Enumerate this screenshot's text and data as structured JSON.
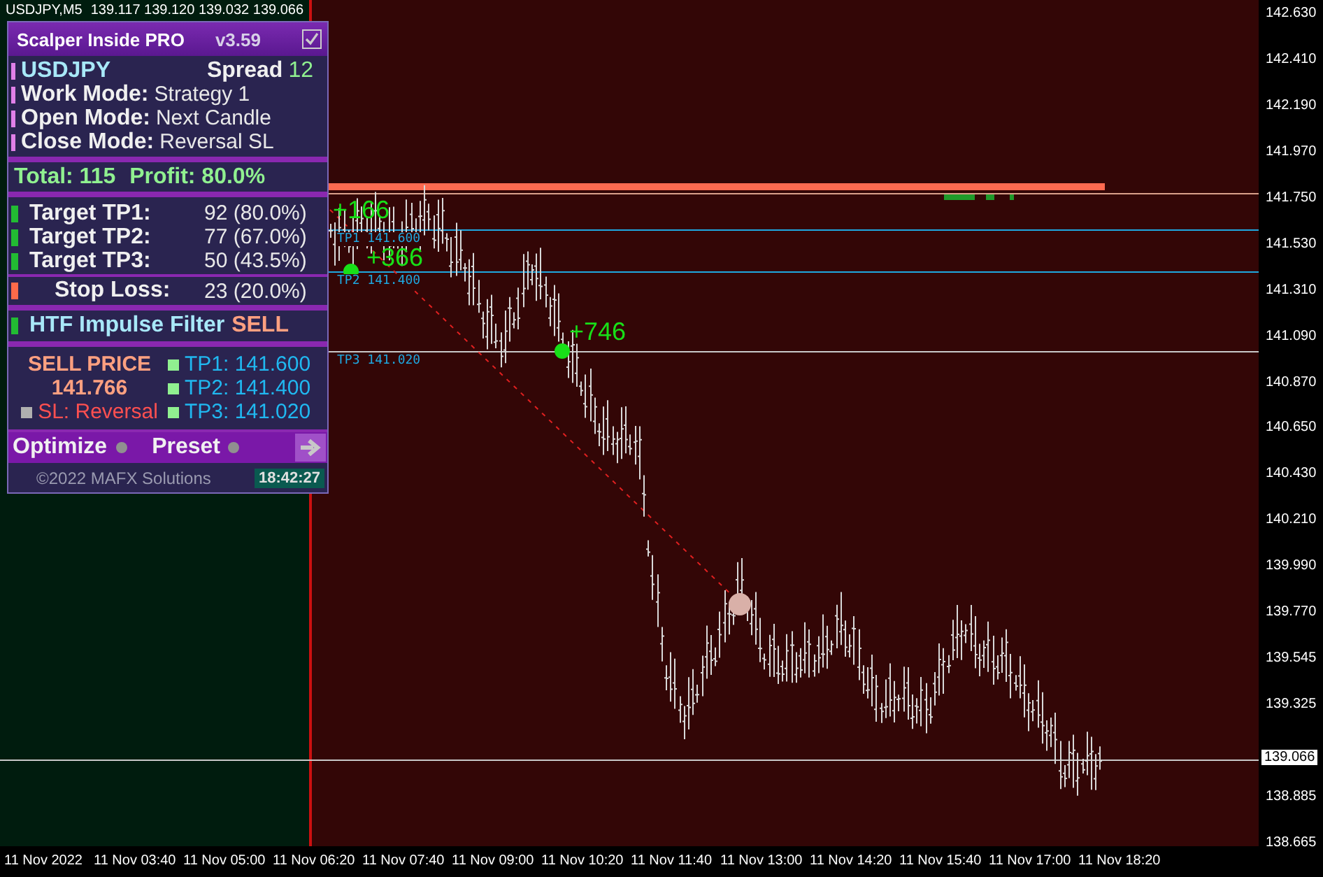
{
  "chart_header": {
    "symbol": "USDJPY,M5",
    "ohlc": "139.117 139.120 139.032 139.066"
  },
  "panel": {
    "title": "Scalper Inside PRO",
    "version": "v3.59",
    "checked": true,
    "symbol": "USDJPY",
    "spread_label": "Spread",
    "spread": "12",
    "modes": [
      {
        "label": "Work Mode:",
        "value": "Strategy 1"
      },
      {
        "label": "Open Mode:",
        "value": "Next Candle"
      },
      {
        "label": "Close Mode:",
        "value": "Reversal SL"
      }
    ],
    "total": "Total: 115",
    "profit": "Profit: 80.0%",
    "targets": [
      {
        "label": "Target TP1:",
        "value": "92 (80.0%)",
        "color": "#22bb33"
      },
      {
        "label": "Target TP2:",
        "value": "77 (67.0%)",
        "color": "#22bb33"
      },
      {
        "label": "Target TP3:",
        "value": "50 (43.5%)",
        "color": "#22bb33"
      }
    ],
    "stop_loss": {
      "label": "Stop Loss:",
      "value": "23 (20.0%)",
      "color": "#ff6a4a"
    },
    "filter": {
      "label": "HTF Impulse Filter",
      "signal": "SELL",
      "color": "#22bb33"
    },
    "price_title": "SELL PRICE",
    "price": "141.766",
    "sl": "SL: Reversal",
    "tps": [
      "TP1: 141.600",
      "TP2: 141.400",
      "TP3: 141.020"
    ],
    "buttons": [
      "Optimize",
      "Preset"
    ],
    "copyright": "©2022 MAFX Solutions",
    "time": "18:42:27"
  },
  "chart": {
    "level_labels": [
      "TP1 141.600",
      "TP2 141.400",
      "TP3 141.020"
    ],
    "hits": [
      "+166",
      "+366",
      "+746"
    ],
    "price_ticks": [
      "142.630",
      "142.410",
      "142.190",
      "141.970",
      "141.750",
      "141.530",
      "141.310",
      "141.090",
      "140.870",
      "140.650",
      "140.430",
      "140.210",
      "139.990",
      "139.770",
      "139.545",
      "139.325",
      "138.885",
      "138.665"
    ],
    "current_price": "139.066",
    "time_ticks": [
      "11 Nov 2022",
      "11 Nov 03:40",
      "11 Nov 05:00",
      "11 Nov 06:20",
      "11 Nov 07:40",
      "11 Nov 09:00",
      "11 Nov 10:20",
      "11 Nov 11:40",
      "11 Nov 13:00",
      "11 Nov 14:20",
      "11 Nov 15:40",
      "11 Nov 17:00",
      "11 Nov 18:20"
    ]
  }
}
